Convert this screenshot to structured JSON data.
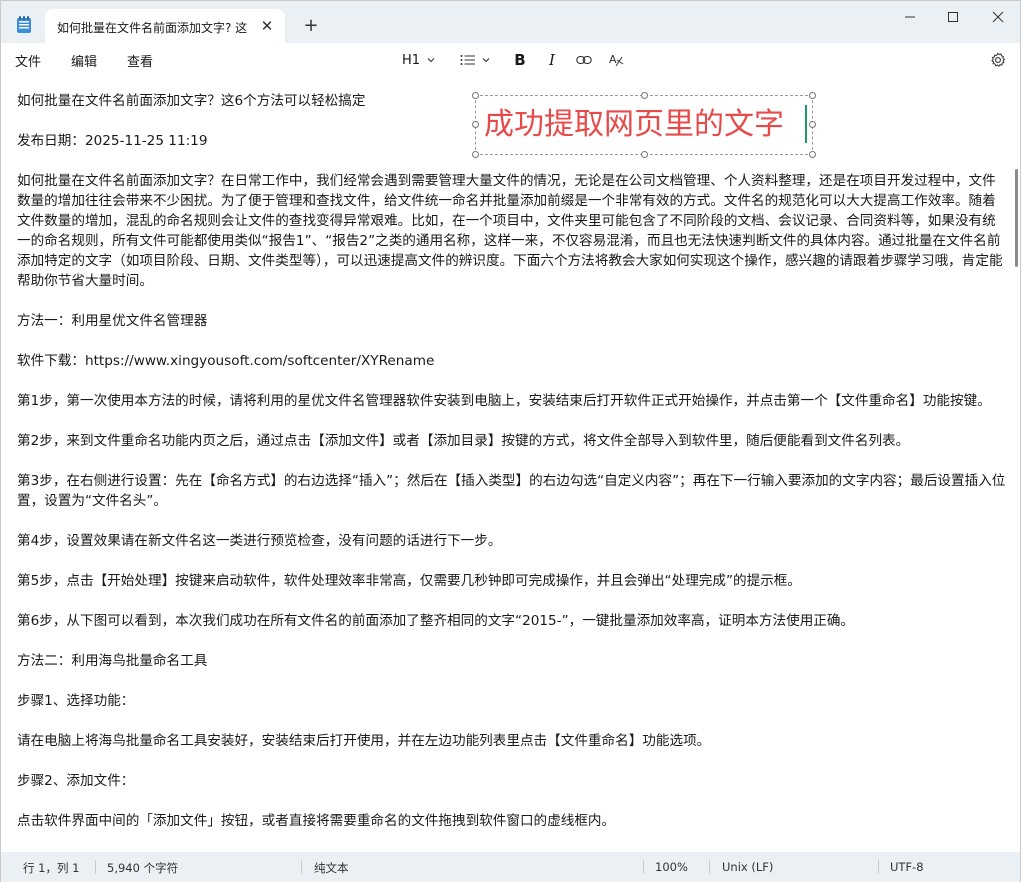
{
  "tab": {
    "title": "如何批量在文件名前面添加文字? 这",
    "close_glyph": "✕",
    "new_tab_glyph": "+"
  },
  "window_controls": {
    "minimize": "—",
    "maximize": "☐",
    "close": "✕"
  },
  "menu": {
    "file": "文件",
    "edit": "编辑",
    "view": "查看"
  },
  "toolbar": {
    "heading": "H1",
    "heading_chevron": "⌵",
    "list_chevron": "⌵",
    "bold": "B",
    "italic": "I"
  },
  "overlay": {
    "text": "成功提取网页里的文字",
    "color": "#e84a4a"
  },
  "document": {
    "paragraphs": [
      "如何批量在文件名前面添加文字？这6个方法可以轻松搞定",
      "发布日期：2025-11-25 11:19",
      " 如何批量在文件名前面添加文字？在日常工作中，我们经常会遇到需要管理大量文件的情况，无论是在公司文档管理、个人资料整理，还是在项目开发过程中，文件数量的增加往往会带来不少困扰。为了便于管理和查找文件，给文件统一命名并批量添加前缀是一个非常有效的方式。文件名的规范化可以大大提高工作效率。随着文件数量的增加，混乱的命名规则会让文件的查找变得异常艰难。比如，在一个项目中，文件夹里可能包含了不同阶段的文档、会议记录、合同资料等，如果没有统一的命名规则，所有文件可能都使用类似“报告1”、“报告2”之类的通用名称，这样一来，不仅容易混淆，而且也无法快速判断文件的具体内容。通过批量在文件名前添加特定的文字（如项目阶段、日期、文件类型等），可以迅速提高文件的辨识度。下面六个方法将教会大家如何实现这个操作，感兴趣的请跟着步骤学习哦，肯定能帮助你节省大量时间。",
      "方法一：利用星优文件名管理器",
      "软件下载：https://www.xingyousoft.com/softcenter/XYRename",
      "第1步，第一次使用本方法的时候，请将利用的星优文件名管理器软件安装到电脑上，安装结束后打开软件正式开始操作，并点击第一个【文件重命名】功能按键。",
      "第2步，来到文件重命名功能内页之后，通过点击【添加文件】或者【添加目录】按键的方式，将文件全部导入到软件里，随后便能看到文件名列表。",
      "第3步，在右侧进行设置：先在【命名方式】的右边选择“插入”；然后在【插入类型】的右边勾选“自定义内容”；再在下一行输入要添加的文字内容；最后设置插入位置，设置为“文件名头”。",
      "第4步，设置效果请在新文件名这一类进行预览检查，没有问题的话进行下一步。",
      "第5步，点击【开始处理】按键来启动软件，软件处理效率非常高，仅需要几秒钟即可完成操作，并且会弹出“处理完成”的提示框。",
      "第6步，从下图可以看到，本次我们成功在所有文件名的前面添加了整齐相同的文字“2015-”，一键批量添加效率高，证明本方法使用正确。",
      "方法二：利用海鸟批量命名工具",
      "步骤1、选择功能：",
      "请在电脑上将海鸟批量命名工具安装好，安装结束后打开使用，并在左边功能列表里点击【文件重命名】功能选项。",
      "步骤2、添加文件：",
      "点击软件界面中间的「添加文件」按钮，或者直接将需要重命名的文件拖拽到软件窗口的虚线框内。"
    ]
  },
  "statusbar": {
    "position": "行 1，列 1",
    "char_count": "5,940 个字符",
    "format": "纯文本",
    "zoom": "100%",
    "line_ending": "Unix (LF)",
    "encoding": "UTF-8"
  }
}
